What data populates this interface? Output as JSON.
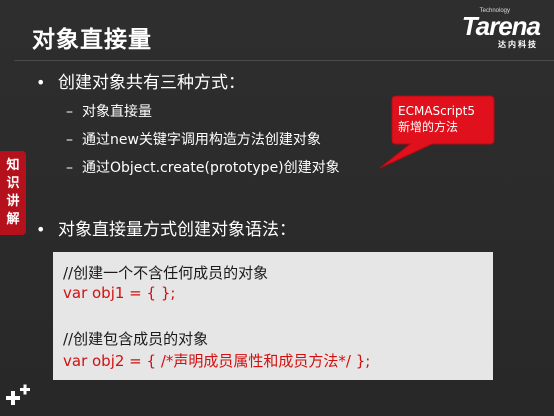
{
  "slide": {
    "title": "对象直接量",
    "logo": {
      "tag": "Technology",
      "brand": "Tarena",
      "subtitle": "达内科技"
    },
    "side_tab": "知识讲解",
    "bullets": [
      {
        "text": "创建对象共有三种方式：",
        "sub_items": [
          "对象直接量",
          "通过new关键字调用构造方法创建对象",
          "通过Object.create(prototype)创建对象"
        ]
      },
      {
        "text": "对象直接量方式创建对象语法："
      }
    ],
    "callout": {
      "line1": "ECMAScript5",
      "line2": "新增的方法",
      "color": "#e0101c"
    },
    "code": {
      "lines": [
        {
          "text": "//创建一个不含任何成员的对象",
          "color": "black"
        },
        {
          "text": "var obj1 = { };",
          "color": "red"
        },
        {
          "text": "",
          "color": "black"
        },
        {
          "text": "//创建包含成员的对象",
          "color": "black"
        },
        {
          "text": "var obj2 = { /*声明成员属性和成员方法*/ };",
          "color": "red"
        }
      ]
    }
  },
  "colors": {
    "background": "#2b2b2b",
    "accent_red": "#b5111d",
    "code_red": "#d40f0f",
    "code_bg": "#e6e6e6"
  },
  "icons": [
    "plus-decoration-icon"
  ]
}
